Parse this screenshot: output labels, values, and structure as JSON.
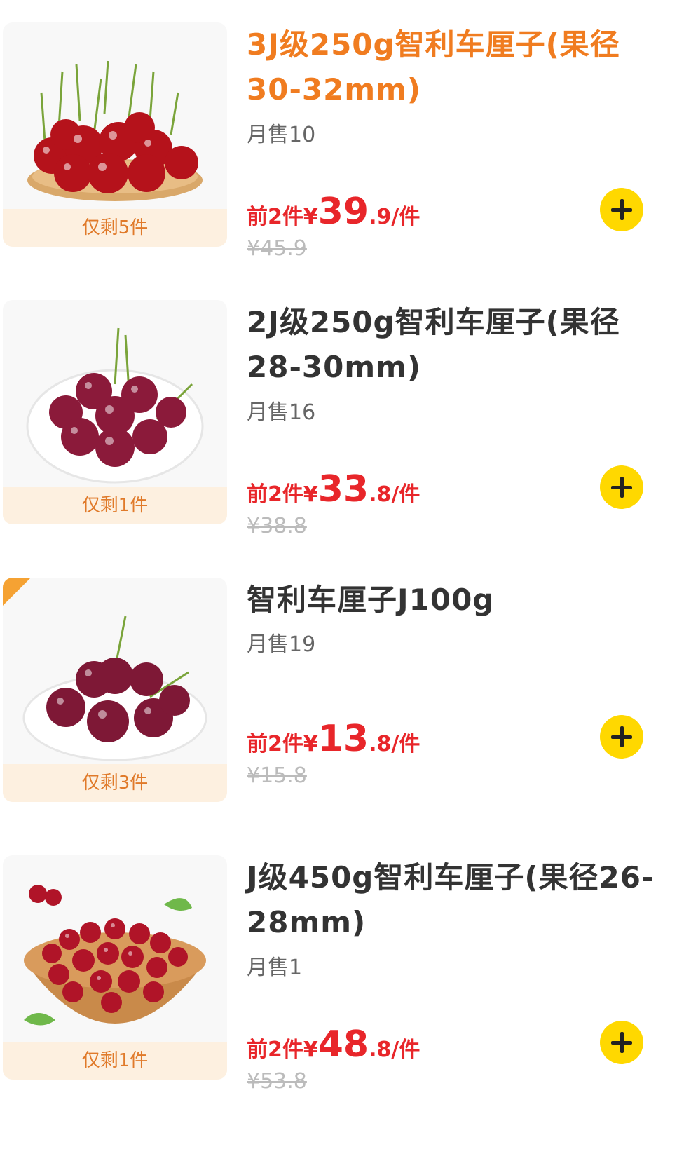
{
  "products": [
    {
      "title": "3J级250g智利车厘子(果径30-32mm)",
      "sales": "月售10",
      "stock": "仅剩5件",
      "price_prefix": "前2件¥",
      "price_int": "39",
      "price_dec": ".9/件",
      "original_price": "¥45.9",
      "image_icon": "cherries-on-wooden-plate-image"
    },
    {
      "title": "2J级250g智利车厘子(果径28-30mm)",
      "sales": "月售16",
      "stock": "仅剩1件",
      "price_prefix": "前2件¥",
      "price_int": "33",
      "price_dec": ".8/件",
      "original_price": "¥38.8",
      "image_icon": "cherries-on-white-plate-image"
    },
    {
      "title": "智利车厘子J100g",
      "sales": "月售19",
      "stock": "仅剩3件",
      "price_prefix": "前2件¥",
      "price_int": "13",
      "price_dec": ".8/件",
      "original_price": "¥15.8",
      "image_icon": "cherries-on-white-plate-image"
    },
    {
      "title": "J级450g智利车厘子(果径26-28mm)",
      "sales": "月售1",
      "stock": "仅剩1件",
      "price_prefix": "前2件¥",
      "price_int": "48",
      "price_dec": ".8/件",
      "original_price": "¥53.8",
      "image_icon": "cherries-in-wooden-bowl-image"
    }
  ],
  "colors": {
    "highlight_title": "#f07c20",
    "price": "#e8262a",
    "add_button": "#ffd800",
    "stock_bg": "#fdf0e0",
    "stock_text": "#e07a2a"
  }
}
